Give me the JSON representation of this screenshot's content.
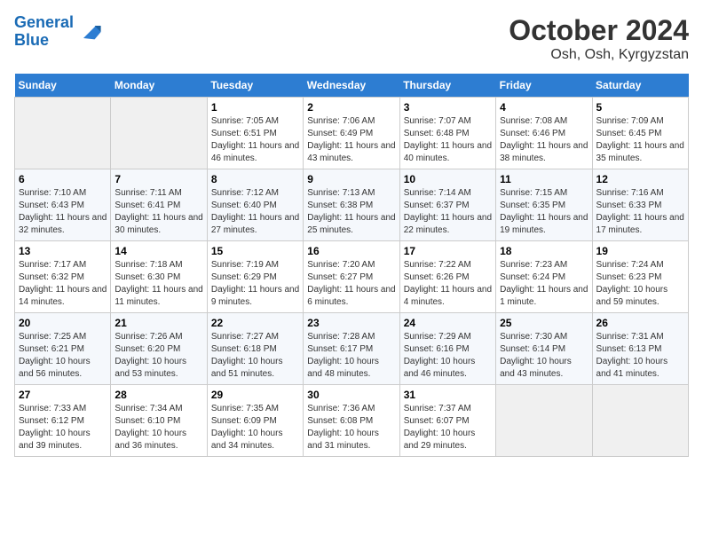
{
  "header": {
    "logo_line1": "General",
    "logo_line2": "Blue",
    "title": "October 2024",
    "subtitle": "Osh, Osh, Kyrgyzstan"
  },
  "days_of_week": [
    "Sunday",
    "Monday",
    "Tuesday",
    "Wednesday",
    "Thursday",
    "Friday",
    "Saturday"
  ],
  "weeks": [
    [
      {
        "day": "",
        "sunrise": "",
        "sunset": "",
        "daylight": ""
      },
      {
        "day": "",
        "sunrise": "",
        "sunset": "",
        "daylight": ""
      },
      {
        "day": "1",
        "sunrise": "Sunrise: 7:05 AM",
        "sunset": "Sunset: 6:51 PM",
        "daylight": "Daylight: 11 hours and 46 minutes."
      },
      {
        "day": "2",
        "sunrise": "Sunrise: 7:06 AM",
        "sunset": "Sunset: 6:49 PM",
        "daylight": "Daylight: 11 hours and 43 minutes."
      },
      {
        "day": "3",
        "sunrise": "Sunrise: 7:07 AM",
        "sunset": "Sunset: 6:48 PM",
        "daylight": "Daylight: 11 hours and 40 minutes."
      },
      {
        "day": "4",
        "sunrise": "Sunrise: 7:08 AM",
        "sunset": "Sunset: 6:46 PM",
        "daylight": "Daylight: 11 hours and 38 minutes."
      },
      {
        "day": "5",
        "sunrise": "Sunrise: 7:09 AM",
        "sunset": "Sunset: 6:45 PM",
        "daylight": "Daylight: 11 hours and 35 minutes."
      }
    ],
    [
      {
        "day": "6",
        "sunrise": "Sunrise: 7:10 AM",
        "sunset": "Sunset: 6:43 PM",
        "daylight": "Daylight: 11 hours and 32 minutes."
      },
      {
        "day": "7",
        "sunrise": "Sunrise: 7:11 AM",
        "sunset": "Sunset: 6:41 PM",
        "daylight": "Daylight: 11 hours and 30 minutes."
      },
      {
        "day": "8",
        "sunrise": "Sunrise: 7:12 AM",
        "sunset": "Sunset: 6:40 PM",
        "daylight": "Daylight: 11 hours and 27 minutes."
      },
      {
        "day": "9",
        "sunrise": "Sunrise: 7:13 AM",
        "sunset": "Sunset: 6:38 PM",
        "daylight": "Daylight: 11 hours and 25 minutes."
      },
      {
        "day": "10",
        "sunrise": "Sunrise: 7:14 AM",
        "sunset": "Sunset: 6:37 PM",
        "daylight": "Daylight: 11 hours and 22 minutes."
      },
      {
        "day": "11",
        "sunrise": "Sunrise: 7:15 AM",
        "sunset": "Sunset: 6:35 PM",
        "daylight": "Daylight: 11 hours and 19 minutes."
      },
      {
        "day": "12",
        "sunrise": "Sunrise: 7:16 AM",
        "sunset": "Sunset: 6:33 PM",
        "daylight": "Daylight: 11 hours and 17 minutes."
      }
    ],
    [
      {
        "day": "13",
        "sunrise": "Sunrise: 7:17 AM",
        "sunset": "Sunset: 6:32 PM",
        "daylight": "Daylight: 11 hours and 14 minutes."
      },
      {
        "day": "14",
        "sunrise": "Sunrise: 7:18 AM",
        "sunset": "Sunset: 6:30 PM",
        "daylight": "Daylight: 11 hours and 11 minutes."
      },
      {
        "day": "15",
        "sunrise": "Sunrise: 7:19 AM",
        "sunset": "Sunset: 6:29 PM",
        "daylight": "Daylight: 11 hours and 9 minutes."
      },
      {
        "day": "16",
        "sunrise": "Sunrise: 7:20 AM",
        "sunset": "Sunset: 6:27 PM",
        "daylight": "Daylight: 11 hours and 6 minutes."
      },
      {
        "day": "17",
        "sunrise": "Sunrise: 7:22 AM",
        "sunset": "Sunset: 6:26 PM",
        "daylight": "Daylight: 11 hours and 4 minutes."
      },
      {
        "day": "18",
        "sunrise": "Sunrise: 7:23 AM",
        "sunset": "Sunset: 6:24 PM",
        "daylight": "Daylight: 11 hours and 1 minute."
      },
      {
        "day": "19",
        "sunrise": "Sunrise: 7:24 AM",
        "sunset": "Sunset: 6:23 PM",
        "daylight": "Daylight: 10 hours and 59 minutes."
      }
    ],
    [
      {
        "day": "20",
        "sunrise": "Sunrise: 7:25 AM",
        "sunset": "Sunset: 6:21 PM",
        "daylight": "Daylight: 10 hours and 56 minutes."
      },
      {
        "day": "21",
        "sunrise": "Sunrise: 7:26 AM",
        "sunset": "Sunset: 6:20 PM",
        "daylight": "Daylight: 10 hours and 53 minutes."
      },
      {
        "day": "22",
        "sunrise": "Sunrise: 7:27 AM",
        "sunset": "Sunset: 6:18 PM",
        "daylight": "Daylight: 10 hours and 51 minutes."
      },
      {
        "day": "23",
        "sunrise": "Sunrise: 7:28 AM",
        "sunset": "Sunset: 6:17 PM",
        "daylight": "Daylight: 10 hours and 48 minutes."
      },
      {
        "day": "24",
        "sunrise": "Sunrise: 7:29 AM",
        "sunset": "Sunset: 6:16 PM",
        "daylight": "Daylight: 10 hours and 46 minutes."
      },
      {
        "day": "25",
        "sunrise": "Sunrise: 7:30 AM",
        "sunset": "Sunset: 6:14 PM",
        "daylight": "Daylight: 10 hours and 43 minutes."
      },
      {
        "day": "26",
        "sunrise": "Sunrise: 7:31 AM",
        "sunset": "Sunset: 6:13 PM",
        "daylight": "Daylight: 10 hours and 41 minutes."
      }
    ],
    [
      {
        "day": "27",
        "sunrise": "Sunrise: 7:33 AM",
        "sunset": "Sunset: 6:12 PM",
        "daylight": "Daylight: 10 hours and 39 minutes."
      },
      {
        "day": "28",
        "sunrise": "Sunrise: 7:34 AM",
        "sunset": "Sunset: 6:10 PM",
        "daylight": "Daylight: 10 hours and 36 minutes."
      },
      {
        "day": "29",
        "sunrise": "Sunrise: 7:35 AM",
        "sunset": "Sunset: 6:09 PM",
        "daylight": "Daylight: 10 hours and 34 minutes."
      },
      {
        "day": "30",
        "sunrise": "Sunrise: 7:36 AM",
        "sunset": "Sunset: 6:08 PM",
        "daylight": "Daylight: 10 hours and 31 minutes."
      },
      {
        "day": "31",
        "sunrise": "Sunrise: 7:37 AM",
        "sunset": "Sunset: 6:07 PM",
        "daylight": "Daylight: 10 hours and 29 minutes."
      },
      {
        "day": "",
        "sunrise": "",
        "sunset": "",
        "daylight": ""
      },
      {
        "day": "",
        "sunrise": "",
        "sunset": "",
        "daylight": ""
      }
    ]
  ]
}
